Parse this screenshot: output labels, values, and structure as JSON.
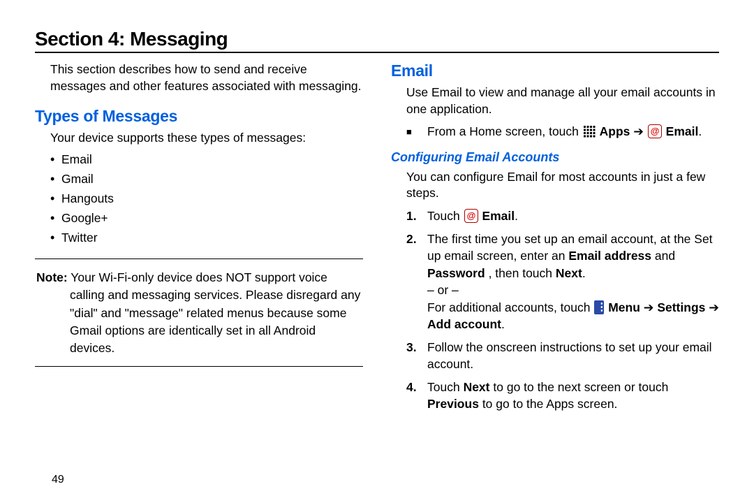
{
  "page_number": "49",
  "section_title": "Section 4: Messaging",
  "left": {
    "intro": "This section describes how to send and receive messages and other features associated with messaging.",
    "heading_types": "Types of Messages",
    "supports_text": "Your device supports these types of messages:",
    "types": [
      "Email",
      "Gmail",
      "Hangouts",
      "Google+",
      "Twitter"
    ],
    "note_label": "Note:",
    "note_body": "Your Wi-Fi-only device does NOT support voice calling and messaging services. Please disregard any \"dial\" and \"message\" related menus because some Gmail options are identically set in all Android devices."
  },
  "right": {
    "heading_email": "Email",
    "email_intro": "Use Email to view and manage all your email accounts in one application.",
    "home_prefix": "From a Home screen, touch ",
    "apps_label": "Apps",
    "arrow": "➔",
    "email_label": "Email",
    "heading_config": "Configuring Email Accounts",
    "config_intro": "You can configure Email for most accounts in just a few steps.",
    "steps": {
      "s1_prefix": "Touch ",
      "s1_label": "Email",
      "s2_a": "The first time you set up an email account, at the Set up email screen, enter an ",
      "s2_email_addr": "Email address",
      "s2_and": " and ",
      "s2_password": "Password",
      "s2_then": ", then touch ",
      "s2_next": "Next",
      "s2_or": "– or –",
      "s2_addl": "For additional accounts, touch ",
      "s2_menu": "Menu",
      "s2_settings": "Settings",
      "s2_addacct": "Add account",
      "s3": "Follow the onscreen instructions to set up your email account.",
      "s4_a": "Touch ",
      "s4_next": "Next",
      "s4_b": " to go to the next screen or touch ",
      "s4_prev": "Previous",
      "s4_c": " to go to the Apps screen."
    }
  }
}
